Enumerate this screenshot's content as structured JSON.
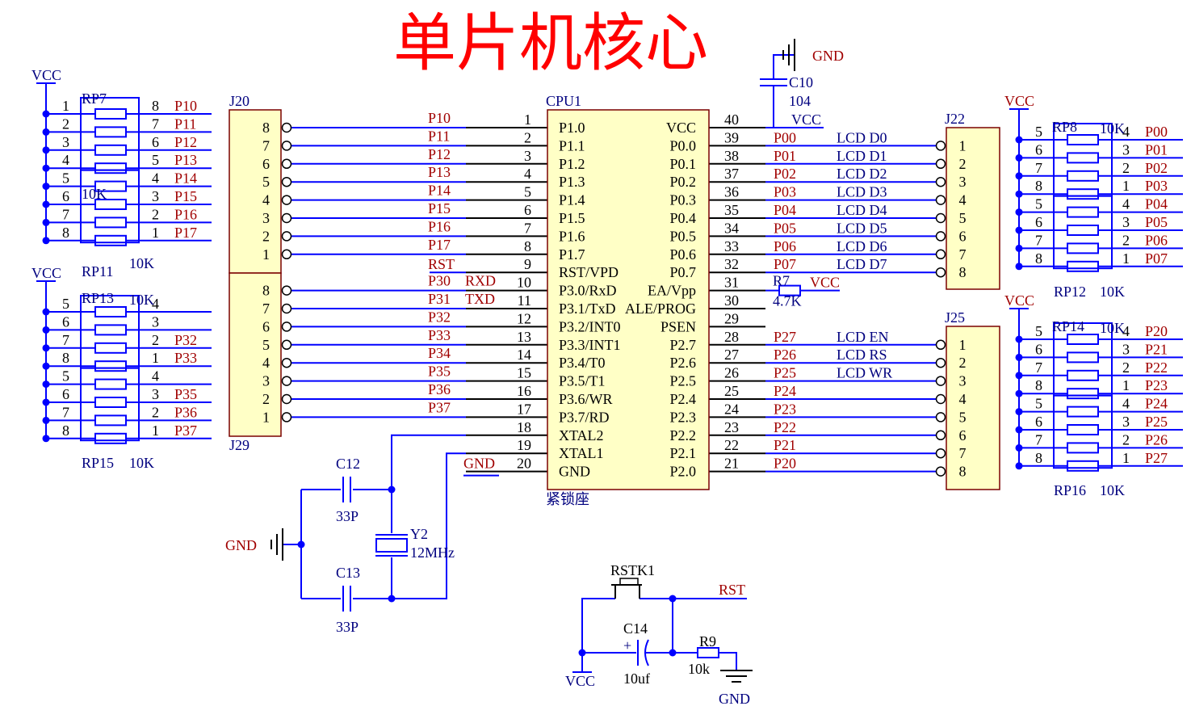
{
  "title": "单片机核心",
  "power": {
    "vcc": "VCC",
    "gnd": "GND"
  },
  "cpu": {
    "ref": "CPU1",
    "socket": "紧锁座",
    "left_pins": [
      {
        "num": "1",
        "name": "P1.0",
        "net": "P10"
      },
      {
        "num": "2",
        "name": "P1.1",
        "net": "P11"
      },
      {
        "num": "3",
        "name": "P1.2",
        "net": "P12"
      },
      {
        "num": "4",
        "name": "P1.3",
        "net": "P13"
      },
      {
        "num": "5",
        "name": "P1.4",
        "net": "P14"
      },
      {
        "num": "6",
        "name": "P1.5",
        "net": "P15"
      },
      {
        "num": "7",
        "name": "P1.6",
        "net": "P16"
      },
      {
        "num": "8",
        "name": "P1.7",
        "net": "P17"
      },
      {
        "num": "9",
        "name": "RST/VPD",
        "net": "RST"
      },
      {
        "num": "10",
        "name": "P3.0/RxD",
        "net": "P30",
        "alt": "RXD"
      },
      {
        "num": "11",
        "name": "P3.1/TxD",
        "net": "P31",
        "alt": "TXD"
      },
      {
        "num": "12",
        "name": "P3.2/INT0",
        "net": "P32"
      },
      {
        "num": "13",
        "name": "P3.3/INT1",
        "net": "P33"
      },
      {
        "num": "14",
        "name": "P3.4/T0",
        "net": "P34"
      },
      {
        "num": "15",
        "name": "P3.5/T1",
        "net": "P35"
      },
      {
        "num": "16",
        "name": "P3.6/WR",
        "net": "P36"
      },
      {
        "num": "17",
        "name": "P3.7/RD",
        "net": "P37"
      },
      {
        "num": "18",
        "name": "XTAL2",
        "net": ""
      },
      {
        "num": "19",
        "name": "XTAL1",
        "net": ""
      },
      {
        "num": "20",
        "name": "GND",
        "net": "GND"
      }
    ],
    "right_pins": [
      {
        "num": "40",
        "name": "VCC",
        "net": "VCC"
      },
      {
        "num": "39",
        "name": "P0.0",
        "net": "P00",
        "label": "LCD D0"
      },
      {
        "num": "38",
        "name": "P0.1",
        "net": "P01",
        "label": "LCD D1"
      },
      {
        "num": "37",
        "name": "P0.2",
        "net": "P02",
        "label": "LCD D2"
      },
      {
        "num": "36",
        "name": "P0.3",
        "net": "P03",
        "label": "LCD D3"
      },
      {
        "num": "35",
        "name": "P0.4",
        "net": "P04",
        "label": "LCD D4"
      },
      {
        "num": "34",
        "name": "P0.5",
        "net": "P05",
        "label": "LCD D5"
      },
      {
        "num": "33",
        "name": "P0.6",
        "net": "P06",
        "label": "LCD D6"
      },
      {
        "num": "32",
        "name": "P0.7",
        "net": "P07",
        "label": "LCD D7"
      },
      {
        "num": "31",
        "name": "EA/Vpp",
        "net": "",
        "label": ""
      },
      {
        "num": "30",
        "name": "ALE/PROG",
        "net": "",
        "label": ""
      },
      {
        "num": "29",
        "name": "PSEN",
        "net": "",
        "label": ""
      },
      {
        "num": "28",
        "name": "P2.7",
        "net": "P27",
        "label": "LCD EN"
      },
      {
        "num": "27",
        "name": "P2.6",
        "net": "P26",
        "label": "LCD RS"
      },
      {
        "num": "26",
        "name": "P2.5",
        "net": "P25",
        "label": "LCD WR"
      },
      {
        "num": "25",
        "name": "P2.4",
        "net": "P24",
        "label": ""
      },
      {
        "num": "24",
        "name": "P2.3",
        "net": "P23",
        "label": ""
      },
      {
        "num": "23",
        "name": "P2.2",
        "net": "P22",
        "label": ""
      },
      {
        "num": "22",
        "name": "P2.1",
        "net": "P21",
        "label": ""
      },
      {
        "num": "21",
        "name": "P2.0",
        "net": "P20",
        "label": ""
      }
    ]
  },
  "headers": [
    {
      "ref": "J20",
      "pins": [
        "8",
        "7",
        "6",
        "5",
        "4",
        "3",
        "2",
        "1"
      ]
    },
    {
      "ref": "J29",
      "pins": [
        "8",
        "7",
        "6",
        "5",
        "4",
        "3",
        "2",
        "1"
      ]
    },
    {
      "ref": "J22",
      "pins": [
        "1",
        "2",
        "3",
        "4",
        "5",
        "6",
        "7",
        "8"
      ]
    },
    {
      "ref": "J25",
      "pins": [
        "1",
        "2",
        "3",
        "4",
        "5",
        "6",
        "7",
        "8"
      ]
    }
  ],
  "rpacks": [
    {
      "refs": [
        "RP7",
        "RP11"
      ],
      "value": "10K",
      "left": [
        "1",
        "2",
        "3",
        "4",
        "5",
        "6",
        "7",
        "8"
      ],
      "right": [
        "8",
        "7",
        "6",
        "5",
        "4",
        "3",
        "2",
        "1"
      ],
      "nets": [
        "P10",
        "P11",
        "P12",
        "P13",
        "P14",
        "P15",
        "P16",
        "P17"
      ]
    },
    {
      "refs": [
        "RP13",
        "RP15"
      ],
      "value": "10K",
      "left": [
        "5",
        "6",
        "7",
        "8",
        "5",
        "6",
        "7",
        "8"
      ],
      "right": [
        "4",
        "3",
        "2",
        "1",
        "4",
        "3",
        "2",
        "1"
      ],
      "nets": [
        "",
        "",
        "P32",
        "P33",
        "",
        "P35",
        "P36",
        "P37"
      ]
    },
    {
      "refs": [
        "RP8",
        "RP12"
      ],
      "value": "10K",
      "left": [
        "5",
        "6",
        "7",
        "8",
        "5",
        "6",
        "7",
        "8"
      ],
      "right": [
        "4",
        "3",
        "2",
        "1",
        "4",
        "3",
        "2",
        "1"
      ],
      "nets": [
        "P00",
        "P01",
        "P02",
        "P03",
        "P04",
        "P05",
        "P06",
        "P07"
      ]
    },
    {
      "refs": [
        "RP14",
        "RP16"
      ],
      "value": "10K",
      "left": [
        "5",
        "6",
        "7",
        "8",
        "5",
        "6",
        "7",
        "8"
      ],
      "right": [
        "4",
        "3",
        "2",
        "1",
        "4",
        "3",
        "2",
        "1"
      ],
      "nets": [
        "P20",
        "P21",
        "P22",
        "P23",
        "P24",
        "P25",
        "P26",
        "P27"
      ]
    }
  ],
  "parts": {
    "c10": {
      "ref": "C10",
      "value": "104"
    },
    "r7": {
      "ref": "R7",
      "value": "4.7K"
    },
    "c12": {
      "ref": "C12",
      "value": "33P"
    },
    "c13": {
      "ref": "C13",
      "value": "33P"
    },
    "y2": {
      "ref": "Y2",
      "value": "12MHz"
    },
    "rstk1": {
      "ref": "RSTK1"
    },
    "c14": {
      "ref": "C14",
      "value": "10uf"
    },
    "r9": {
      "ref": "R9",
      "value": "10k"
    },
    "rst_net": "RST"
  }
}
